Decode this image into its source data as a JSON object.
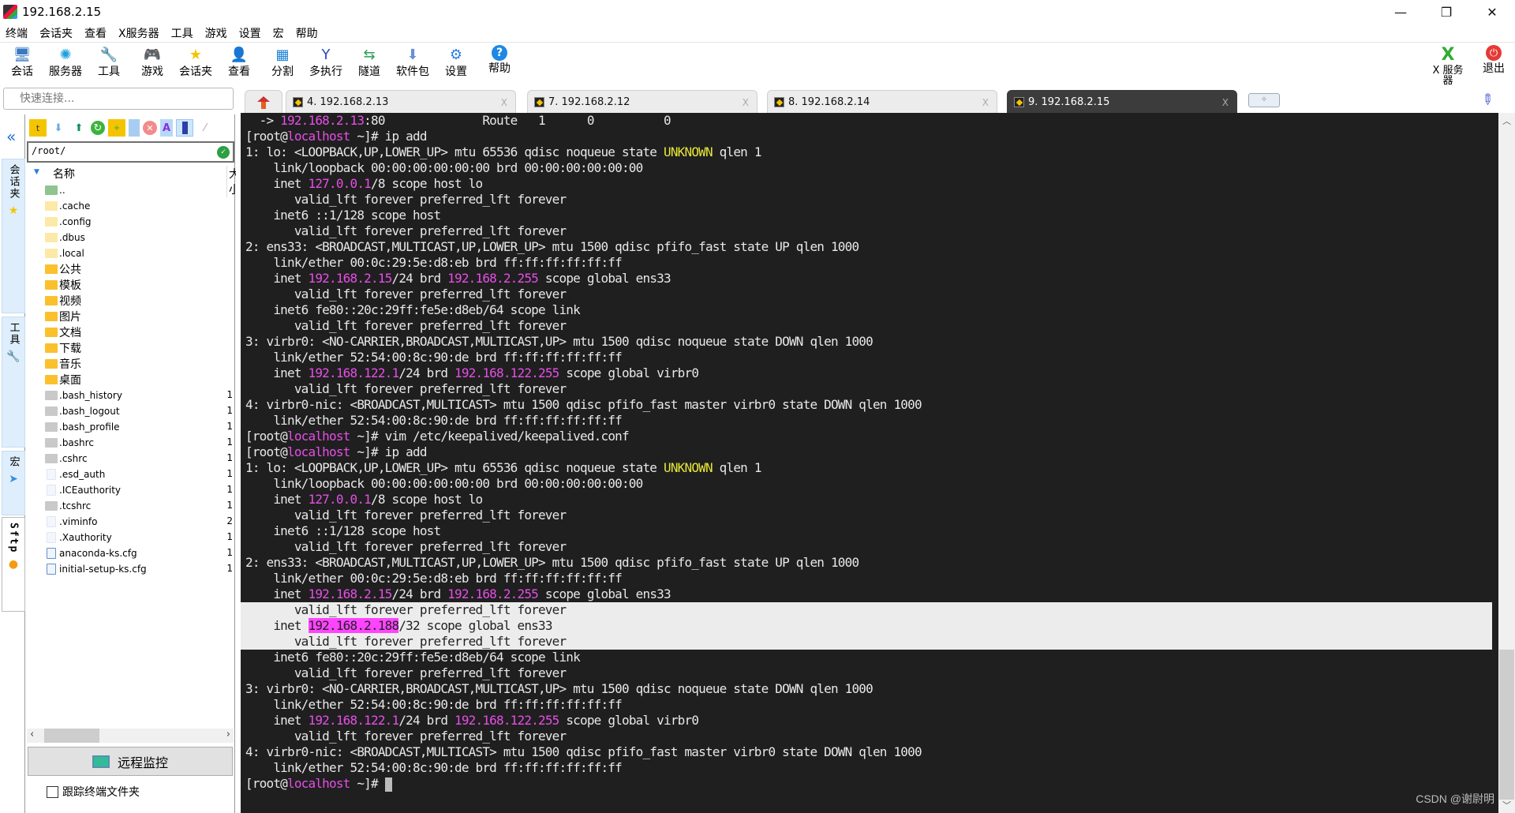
{
  "window": {
    "title": "192.168.2.15",
    "minimize": "—",
    "restore": "❐",
    "close": "✕"
  },
  "menu": [
    "终端",
    "会话夹",
    "查看",
    "X服务器",
    "工具",
    "游戏",
    "设置",
    "宏",
    "帮助"
  ],
  "toolbar": [
    {
      "label": "会话",
      "icon": "session-icon",
      "glyph": "🖥"
    },
    {
      "label": "服务器",
      "icon": "servers-icon",
      "glyph": "✺"
    },
    {
      "label": "工具",
      "icon": "tools-icon",
      "glyph": "🔧"
    },
    {
      "label": "游戏",
      "icon": "games-icon",
      "glyph": "🎮"
    },
    {
      "label": "会话夹",
      "icon": "star-icon",
      "glyph": "★"
    },
    {
      "label": "查看",
      "icon": "view-icon",
      "glyph": "👤"
    },
    {
      "label": "分割",
      "icon": "split-icon",
      "glyph": "▦"
    },
    {
      "label": "多执行",
      "icon": "multiexec-icon",
      "glyph": "Y"
    },
    {
      "label": "隧道",
      "icon": "tunnel-icon",
      "glyph": "⇆"
    },
    {
      "label": "软件包",
      "icon": "packages-icon",
      "glyph": "⬇"
    },
    {
      "label": "设置",
      "icon": "settings-icon",
      "glyph": "⚙"
    },
    {
      "label": "帮助",
      "icon": "help-icon",
      "glyph": "?"
    }
  ],
  "toolbar_right": [
    {
      "label": "X 服务器",
      "icon": "x-server-icon",
      "glyph": "X"
    },
    {
      "label": "退出",
      "icon": "power-icon",
      "glyph": "⏻"
    }
  ],
  "quick_connect": {
    "placeholder": "快速连接..."
  },
  "tabs": [
    {
      "label": "4. 192.168.2.13",
      "active": false
    },
    {
      "label": "7. 192.168.2.12",
      "active": false
    },
    {
      "label": "8. 192.168.2.14",
      "active": false
    },
    {
      "label": "9. 192.168.2.15",
      "active": true
    }
  ],
  "tab_close": "X",
  "new_tab": "✧",
  "sidetabs": [
    {
      "label": "会话夹",
      "icon": "star-icon",
      "glyph": "★"
    },
    {
      "label": "工具",
      "icon": "tools-icon",
      "glyph": "🔧"
    },
    {
      "label": "宏",
      "icon": "send-icon",
      "glyph": "➤"
    },
    {
      "label": "Sftp",
      "icon": "globe-icon",
      "glyph": "●"
    }
  ],
  "sftp": {
    "path": "/root/",
    "col_name": "名称",
    "col_size": "大小",
    "files": [
      {
        "name": "..",
        "type": "up",
        "size": ""
      },
      {
        "name": ".cache",
        "type": "hdir",
        "size": ""
      },
      {
        "name": ".config",
        "type": "hdir",
        "size": ""
      },
      {
        "name": ".dbus",
        "type": "hdir",
        "size": ""
      },
      {
        "name": ".local",
        "type": "hdir",
        "size": ""
      },
      {
        "name": "公共",
        "type": "dir",
        "size": ""
      },
      {
        "name": "模板",
        "type": "dir",
        "size": ""
      },
      {
        "name": "视频",
        "type": "dir",
        "size": ""
      },
      {
        "name": "图片",
        "type": "dir",
        "size": ""
      },
      {
        "name": "文档",
        "type": "dir",
        "size": ""
      },
      {
        "name": "下载",
        "type": "dir",
        "size": ""
      },
      {
        "name": "音乐",
        "type": "dir",
        "size": ""
      },
      {
        "name": "桌面",
        "type": "dir",
        "size": ""
      },
      {
        "name": ".bash_history",
        "type": "sh",
        "size": "1"
      },
      {
        "name": ".bash_logout",
        "type": "sh",
        "size": "1"
      },
      {
        "name": ".bash_profile",
        "type": "sh",
        "size": "1"
      },
      {
        "name": ".bashrc",
        "type": "sh",
        "size": "1"
      },
      {
        "name": ".cshrc",
        "type": "sh",
        "size": "1"
      },
      {
        "name": ".esd_auth",
        "type": "doc",
        "size": "1"
      },
      {
        "name": ".ICEauthority",
        "type": "doc",
        "size": "1"
      },
      {
        "name": ".tcshrc",
        "type": "sh",
        "size": "1"
      },
      {
        "name": ".viminfo",
        "type": "doc",
        "size": "2"
      },
      {
        "name": ".Xauthority",
        "type": "doc",
        "size": "1"
      },
      {
        "name": "anaconda-ks.cfg",
        "type": "cfg",
        "size": "1"
      },
      {
        "name": "initial-setup-ks.cfg",
        "type": "cfg",
        "size": "1"
      }
    ],
    "remote_monitor": "远程监控",
    "follow_terminal": "跟踪终端文件夹",
    "follow_checked": false
  },
  "terminal": {
    "lines": [
      {
        "segs": [
          [
            "  -> ",
            ""
          ],
          [
            "192.168.2.13",
            "mag"
          ],
          [
            ":80              Route   1      0          0",
            ""
          ]
        ]
      },
      {
        "segs": [
          [
            "[root@",
            ""
          ],
          [
            "localhost",
            "mag"
          ],
          [
            " ~]# ip add",
            ""
          ]
        ]
      },
      {
        "segs": [
          [
            "1: lo: <LOOPBACK,UP,LOWER_UP> mtu 65536 qdisc noqueue state ",
            ""
          ],
          [
            "UNKNOWN",
            "yel"
          ],
          [
            " qlen 1",
            ""
          ]
        ]
      },
      {
        "segs": [
          [
            "    link/loopback 00:00:00:00:00:00 brd 00:00:00:00:00:00",
            ""
          ]
        ]
      },
      {
        "segs": [
          [
            "    inet ",
            ""
          ],
          [
            "127.0.0.1",
            "mag"
          ],
          [
            "/8 scope host lo",
            ""
          ]
        ]
      },
      {
        "segs": [
          [
            "       valid_lft forever preferred_lft forever",
            ""
          ]
        ]
      },
      {
        "segs": [
          [
            "    inet6 ::1/128 scope host",
            ""
          ]
        ]
      },
      {
        "segs": [
          [
            "       valid_lft forever preferred_lft forever",
            ""
          ]
        ]
      },
      {
        "segs": [
          [
            "2: ens33: <BROADCAST,MULTICAST,UP,LOWER_UP> mtu 1500 qdisc pfifo_fast state UP qlen 1000",
            ""
          ]
        ]
      },
      {
        "segs": [
          [
            "    link/ether 00:0c:29:5e:d8:eb brd ff:ff:ff:ff:ff:ff",
            ""
          ]
        ]
      },
      {
        "segs": [
          [
            "    inet ",
            ""
          ],
          [
            "192.168.2.15",
            "mag"
          ],
          [
            "/24 brd ",
            ""
          ],
          [
            "192.168.2.255",
            "mag"
          ],
          [
            " scope global ens33",
            ""
          ]
        ]
      },
      {
        "segs": [
          [
            "       valid_lft forever preferred_lft forever",
            ""
          ]
        ]
      },
      {
        "segs": [
          [
            "    inet6 fe80::20c:29ff:fe5e:d8eb/64 scope link",
            ""
          ]
        ]
      },
      {
        "segs": [
          [
            "       valid_lft forever preferred_lft forever",
            ""
          ]
        ]
      },
      {
        "segs": [
          [
            "3: virbr0: <NO-CARRIER,BROADCAST,MULTICAST,UP> mtu 1500 qdisc noqueue state DOWN qlen 1000",
            ""
          ]
        ]
      },
      {
        "segs": [
          [
            "    link/ether 52:54:00:8c:90:de brd ff:ff:ff:ff:ff:ff",
            ""
          ]
        ]
      },
      {
        "segs": [
          [
            "    inet ",
            ""
          ],
          [
            "192.168.122.1",
            "mag"
          ],
          [
            "/24 brd ",
            ""
          ],
          [
            "192.168.122.255",
            "mag"
          ],
          [
            " scope global virbr0",
            ""
          ]
        ]
      },
      {
        "segs": [
          [
            "       valid_lft forever preferred_lft forever",
            ""
          ]
        ]
      },
      {
        "segs": [
          [
            "4: virbr0-nic: <BROADCAST,MULTICAST> mtu 1500 qdisc pfifo_fast master virbr0 state DOWN qlen 1000",
            ""
          ]
        ]
      },
      {
        "segs": [
          [
            "    link/ether 52:54:00:8c:90:de brd ff:ff:ff:ff:ff:ff",
            ""
          ]
        ]
      },
      {
        "segs": [
          [
            "[root@",
            ""
          ],
          [
            "localhost",
            "mag"
          ],
          [
            " ~]# vim /etc/keepalived/keepalived.conf",
            ""
          ]
        ]
      },
      {
        "segs": [
          [
            "[root@",
            ""
          ],
          [
            "localhost",
            "mag"
          ],
          [
            " ~]# ip add",
            ""
          ]
        ]
      },
      {
        "segs": [
          [
            "1: lo: <LOOPBACK,UP,LOWER_UP> mtu 65536 qdisc noqueue state ",
            ""
          ],
          [
            "UNKNOWN",
            "yel"
          ],
          [
            " qlen 1",
            ""
          ]
        ]
      },
      {
        "segs": [
          [
            "    link/loopback 00:00:00:00:00:00 brd 00:00:00:00:00:00",
            ""
          ]
        ]
      },
      {
        "segs": [
          [
            "    inet ",
            ""
          ],
          [
            "127.0.0.1",
            "mag"
          ],
          [
            "/8 scope host lo",
            ""
          ]
        ]
      },
      {
        "segs": [
          [
            "       valid_lft forever preferred_lft forever",
            ""
          ]
        ]
      },
      {
        "segs": [
          [
            "    inet6 ::1/128 scope host",
            ""
          ]
        ]
      },
      {
        "segs": [
          [
            "       valid_lft forever preferred_lft forever",
            ""
          ]
        ]
      },
      {
        "segs": [
          [
            "2: ens33: <BROADCAST,MULTICAST,UP,LOWER_UP> mtu 1500 qdisc pfifo_fast state UP qlen 1000",
            ""
          ]
        ]
      },
      {
        "segs": [
          [
            "    link/ether 00:0c:29:5e:d8:eb brd ff:ff:ff:ff:ff:ff",
            ""
          ]
        ]
      },
      {
        "segs": [
          [
            "    inet ",
            ""
          ],
          [
            "192.168.2.15",
            "mag"
          ],
          [
            "/24 brd ",
            ""
          ],
          [
            "192.168.2.255",
            "mag"
          ],
          [
            " scope global ens33",
            ""
          ]
        ]
      },
      {
        "hl": true,
        "segs": [
          [
            "       valid_lft forever preferred_lft forever",
            ""
          ]
        ]
      },
      {
        "hl": true,
        "segs": [
          [
            "    inet ",
            ""
          ],
          [
            "192.168.2.188",
            "hlmag"
          ],
          [
            "/32 scope global ens33",
            ""
          ]
        ]
      },
      {
        "hl": true,
        "segs": [
          [
            "       valid_lft forever preferred_lft forever",
            ""
          ]
        ]
      },
      {
        "segs": [
          [
            "    inet6 fe80::20c:29ff:fe5e:d8eb/64 scope link",
            ""
          ]
        ]
      },
      {
        "segs": [
          [
            "       valid_lft forever preferred_lft forever",
            ""
          ]
        ]
      },
      {
        "segs": [
          [
            "3: virbr0: <NO-CARRIER,BROADCAST,MULTICAST,UP> mtu 1500 qdisc noqueue state DOWN qlen 1000",
            ""
          ]
        ]
      },
      {
        "segs": [
          [
            "    link/ether 52:54:00:8c:90:de brd ff:ff:ff:ff:ff:ff",
            ""
          ]
        ]
      },
      {
        "segs": [
          [
            "    inet ",
            ""
          ],
          [
            "192.168.122.1",
            "mag"
          ],
          [
            "/24 brd ",
            ""
          ],
          [
            "192.168.122.255",
            "mag"
          ],
          [
            " scope global virbr0",
            ""
          ]
        ]
      },
      {
        "segs": [
          [
            "       valid_lft forever preferred_lft forever",
            ""
          ]
        ]
      },
      {
        "segs": [
          [
            "4: virbr0-nic: <BROADCAST,MULTICAST> mtu 1500 qdisc pfifo_fast master virbr0 state DOWN qlen 1000",
            ""
          ]
        ]
      },
      {
        "segs": [
          [
            "    link/ether 52:54:00:8c:90:de brd ff:ff:ff:ff:ff:ff",
            ""
          ]
        ]
      },
      {
        "prompt": true,
        "segs": [
          [
            "[root@",
            ""
          ],
          [
            "localhost",
            "mag"
          ],
          [
            " ~]# ",
            ""
          ]
        ]
      }
    ]
  },
  "watermark": "CSDN @谢尉明"
}
